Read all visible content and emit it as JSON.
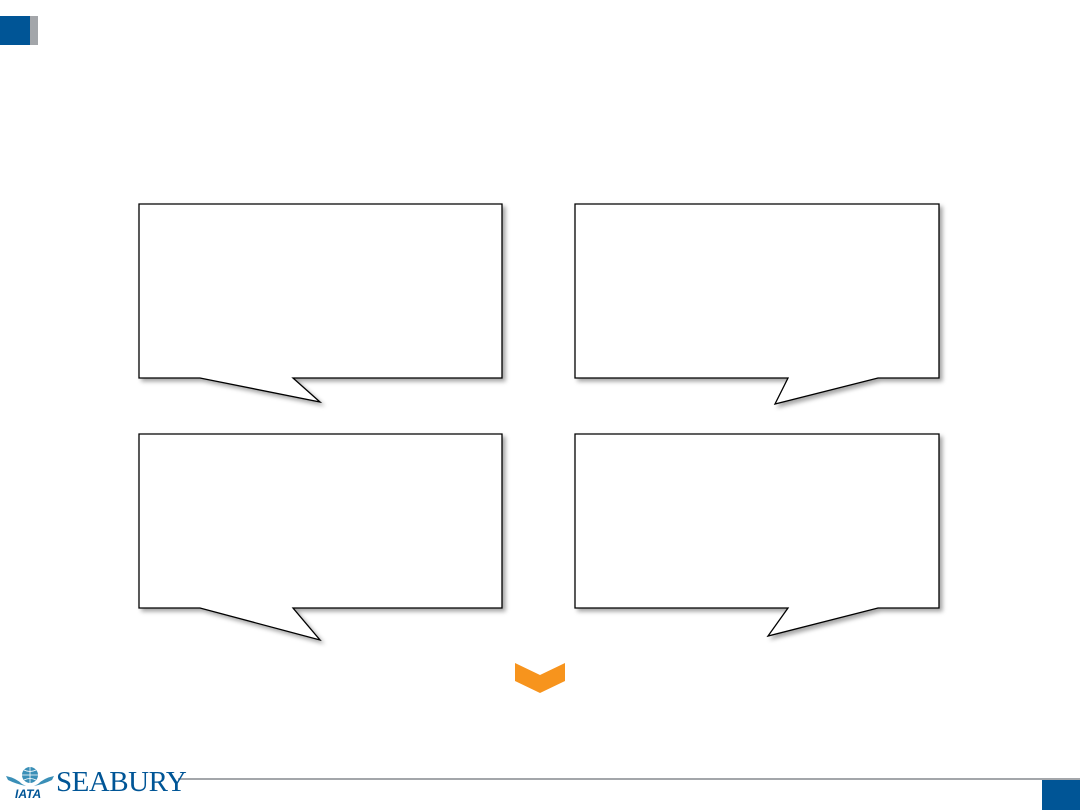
{
  "brand": {
    "logo_text": "SEABURY",
    "logo_badge": "IATA",
    "primary_color": "#005596",
    "accent_color": "#f7941d",
    "gray": "#a3a6aa"
  },
  "callouts": [
    {
      "text": ""
    },
    {
      "text": ""
    },
    {
      "text": ""
    },
    {
      "text": ""
    }
  ],
  "icons": {
    "down_chevron": "chevron-down-icon"
  }
}
